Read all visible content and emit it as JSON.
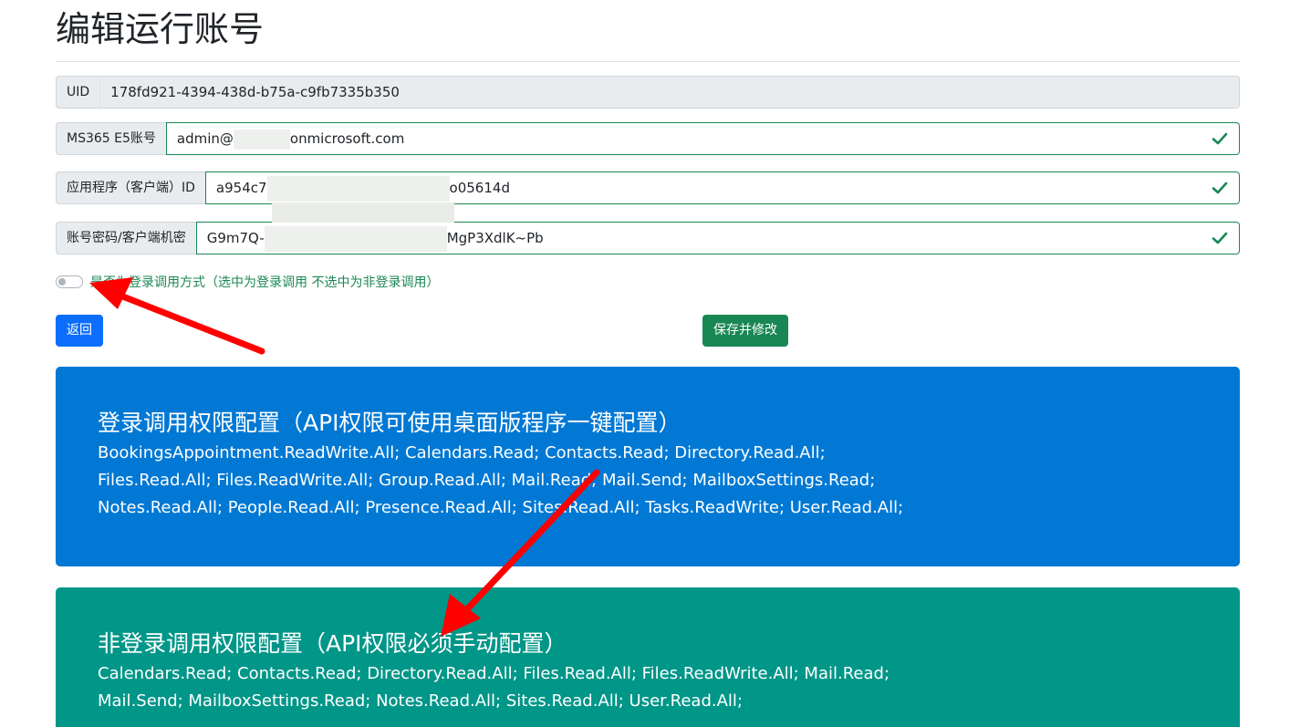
{
  "page": {
    "title": "编辑运行账号"
  },
  "fields": {
    "uid": {
      "label": "UID",
      "value": "178fd921-4394-438d-b75a-c9fb7335b350"
    },
    "account": {
      "label": "MS365 E5账号",
      "value_start": "admin@",
      "value_end": "onmicrosoft.com"
    },
    "client_id": {
      "label": "应用程序（客户端）ID",
      "value_start": "a954c7",
      "value_end": "o05614d"
    },
    "secret": {
      "label": "账号密码/客户端机密",
      "value_start": "G9m7Q-",
      "value_end": "MgP3XdlK~Pb"
    }
  },
  "toggle": {
    "label": "是否为登录调用方式（选中为登录调用 不选中为非登录调用）",
    "checked": false
  },
  "buttons": {
    "back": "返回",
    "save": "保存并修改"
  },
  "panels": {
    "login": {
      "title": "登录调用权限配置（API权限可使用桌面版程序一键配置）",
      "lines": [
        "BookingsAppointment.ReadWrite.All; Calendars.Read; Contacts.Read; Directory.Read.All;",
        "Files.Read.All; Files.ReadWrite.All; Group.Read.All; Mail.Read; Mail.Send; MailboxSettings.Read;",
        "Notes.Read.All; People.Read.All; Presence.Read.All; Sites.Read.All; Tasks.ReadWrite; User.Read.All;"
      ]
    },
    "nonlogin": {
      "title": "非登录调用权限配置（API权限必须手动配置）",
      "lines": [
        "Calendars.Read; Contacts.Read; Directory.Read.All; Files.Read.All; Files.ReadWrite.All; Mail.Read;",
        "Mail.Send; MailboxSettings.Read; Notes.Read.All; Sites.Read.All; User.Read.All;"
      ]
    }
  },
  "colors": {
    "primary": "#0d6efd",
    "success": "#198754",
    "panel_blue": "#0078d4",
    "panel_teal": "#009688",
    "annotation_arrow": "#ff0000"
  }
}
